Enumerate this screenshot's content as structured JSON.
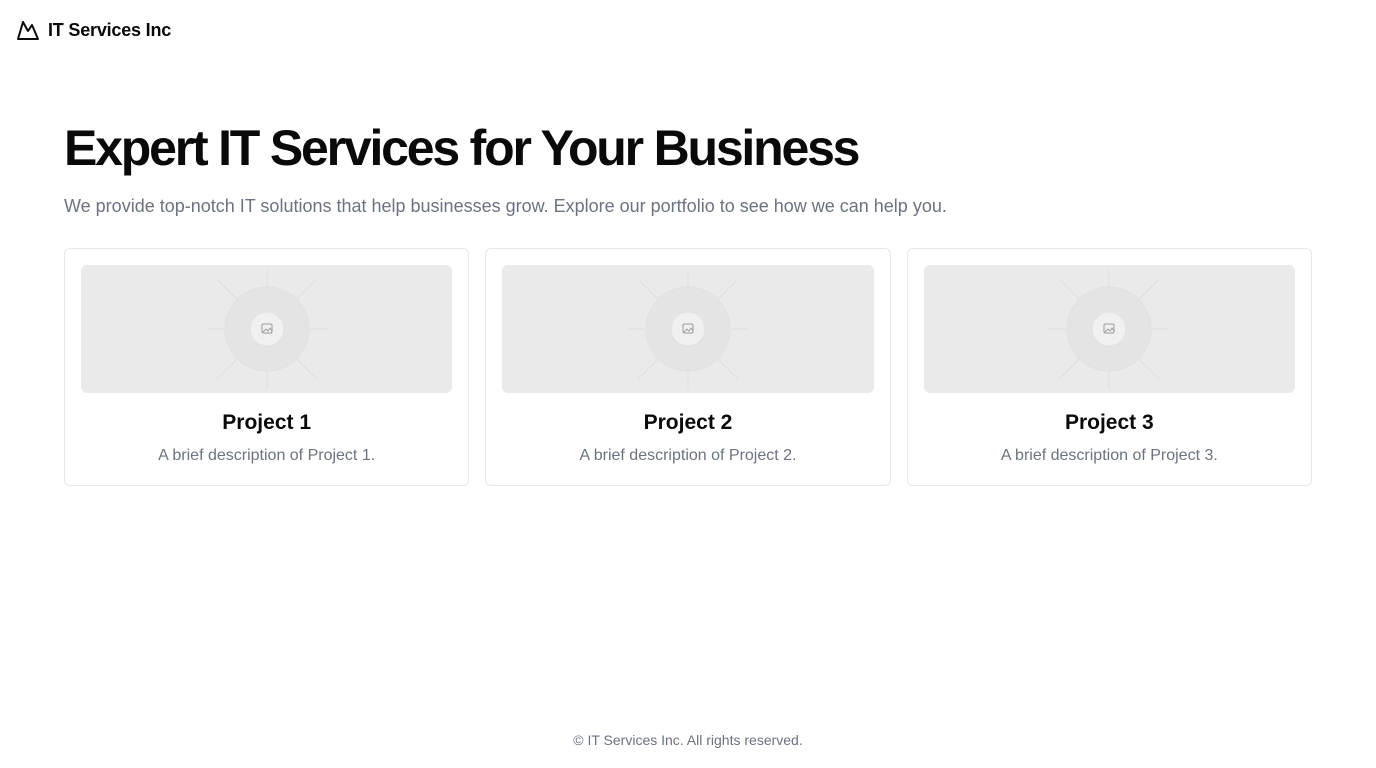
{
  "header": {
    "logo_icon": "mountain-icon",
    "brand": "IT Services Inc"
  },
  "hero": {
    "title": "Expert IT Services for Your Business",
    "subtitle": "We provide top-notch IT solutions that help businesses grow. Explore our portfolio to see how we can help you."
  },
  "projects": [
    {
      "title": "Project 1",
      "description": "A brief description of Project 1.",
      "image_icon": "image-placeholder-icon"
    },
    {
      "title": "Project 2",
      "description": "A brief description of Project 2.",
      "image_icon": "image-placeholder-icon"
    },
    {
      "title": "Project 3",
      "description": "A brief description of Project 3.",
      "image_icon": "image-placeholder-icon"
    }
  ],
  "footer": {
    "copyright": "© IT Services Inc. All rights reserved."
  },
  "colors": {
    "text": "#0a0a0a",
    "muted": "#6b7280",
    "border": "#e5e7eb",
    "placeholder_bg": "#eaeaea"
  }
}
